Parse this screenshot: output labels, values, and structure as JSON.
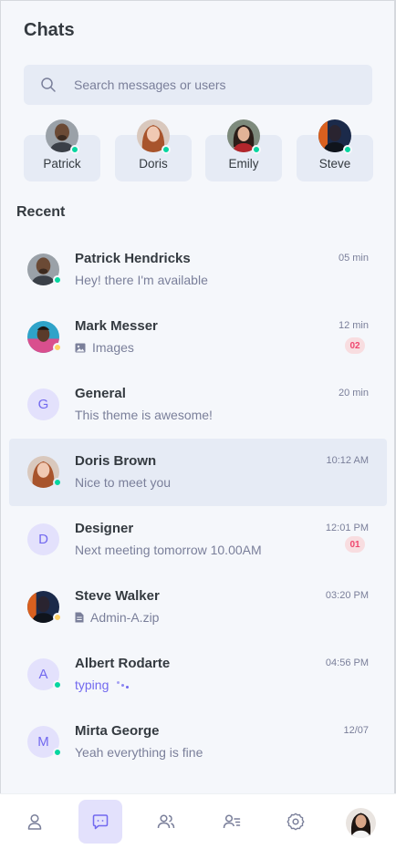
{
  "header": {
    "title": "Chats"
  },
  "search": {
    "placeholder": "Search messages or users"
  },
  "online_users": [
    {
      "name": "Patrick",
      "status": "online"
    },
    {
      "name": "Doris",
      "status": "online"
    },
    {
      "name": "Emily",
      "status": "online"
    },
    {
      "name": "Steve",
      "status": "online"
    }
  ],
  "recent": {
    "title": "Recent",
    "chats": [
      {
        "name": "Patrick Hendricks",
        "message": "Hey! there I'm available",
        "time": "05 min",
        "status": "online"
      },
      {
        "name": "Mark Messer",
        "message": "Images",
        "message_icon": "image-icon",
        "time": "12 min",
        "unread": "02",
        "status": "away"
      },
      {
        "name": "General",
        "initial": "G",
        "message": "This theme is awesome!",
        "time": "20 min"
      },
      {
        "name": "Doris Brown",
        "message": "Nice to meet you",
        "time": "10:12 AM",
        "status": "online",
        "active": true
      },
      {
        "name": "Designer",
        "initial": "D",
        "message": "Next meeting tomorrow 10.00AM",
        "time": "12:01 PM",
        "unread": "01"
      },
      {
        "name": "Steve Walker",
        "message": "Admin-A.zip",
        "message_icon": "file-icon",
        "time": "03:20 PM",
        "status": "away"
      },
      {
        "name": "Albert Rodarte",
        "initial": "A",
        "message": "typing",
        "typing": true,
        "time": "04:56 PM",
        "status": "online"
      },
      {
        "name": "Mirta George",
        "initial": "M",
        "message": "Yeah everything is fine",
        "time": "12/07",
        "status": "online"
      }
    ]
  },
  "bottom_nav": {
    "items": [
      {
        "icon": "profile-icon"
      },
      {
        "icon": "chat-icon",
        "active": true
      },
      {
        "icon": "groups-icon"
      },
      {
        "icon": "contacts-icon"
      },
      {
        "icon": "settings-icon"
      },
      {
        "icon": "user-avatar"
      }
    ]
  },
  "colors": {
    "accent": "#7269ef",
    "online": "#06d6a0",
    "away": "#ffd166",
    "badge_bg": "#f8dde0",
    "badge_text": "#ef476f",
    "card_bg": "#e6ebf5",
    "page_bg": "#f5f7fb"
  }
}
